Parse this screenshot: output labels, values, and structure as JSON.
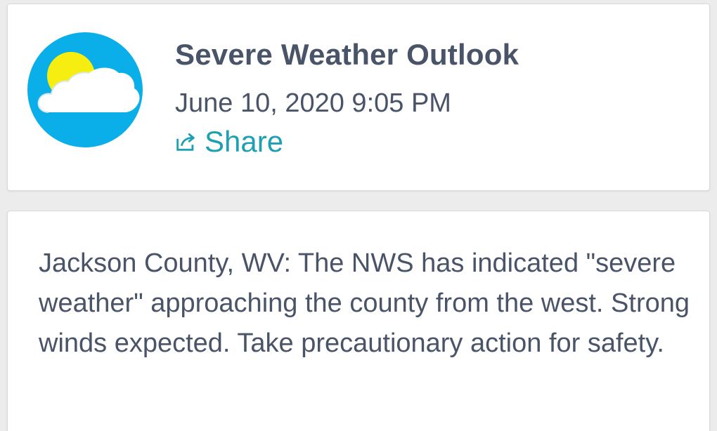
{
  "post": {
    "title": "Severe Weather Outlook",
    "datetime": "June 10, 2020 9:05 PM",
    "share_label": "Share",
    "icons": {
      "avatar": "sun-behind-cloud-icon",
      "share": "share-icon"
    }
  },
  "message": {
    "text": "Jackson County, WV: The NWS has indicated \"severe weather\" approaching the county from the west. Strong winds expected. Take precautionary action for safety."
  },
  "colors": {
    "text": "#4a5468",
    "accent": "#1f9fb2",
    "avatar_bg": "#0aaee8",
    "sun": "#f5ee10"
  }
}
